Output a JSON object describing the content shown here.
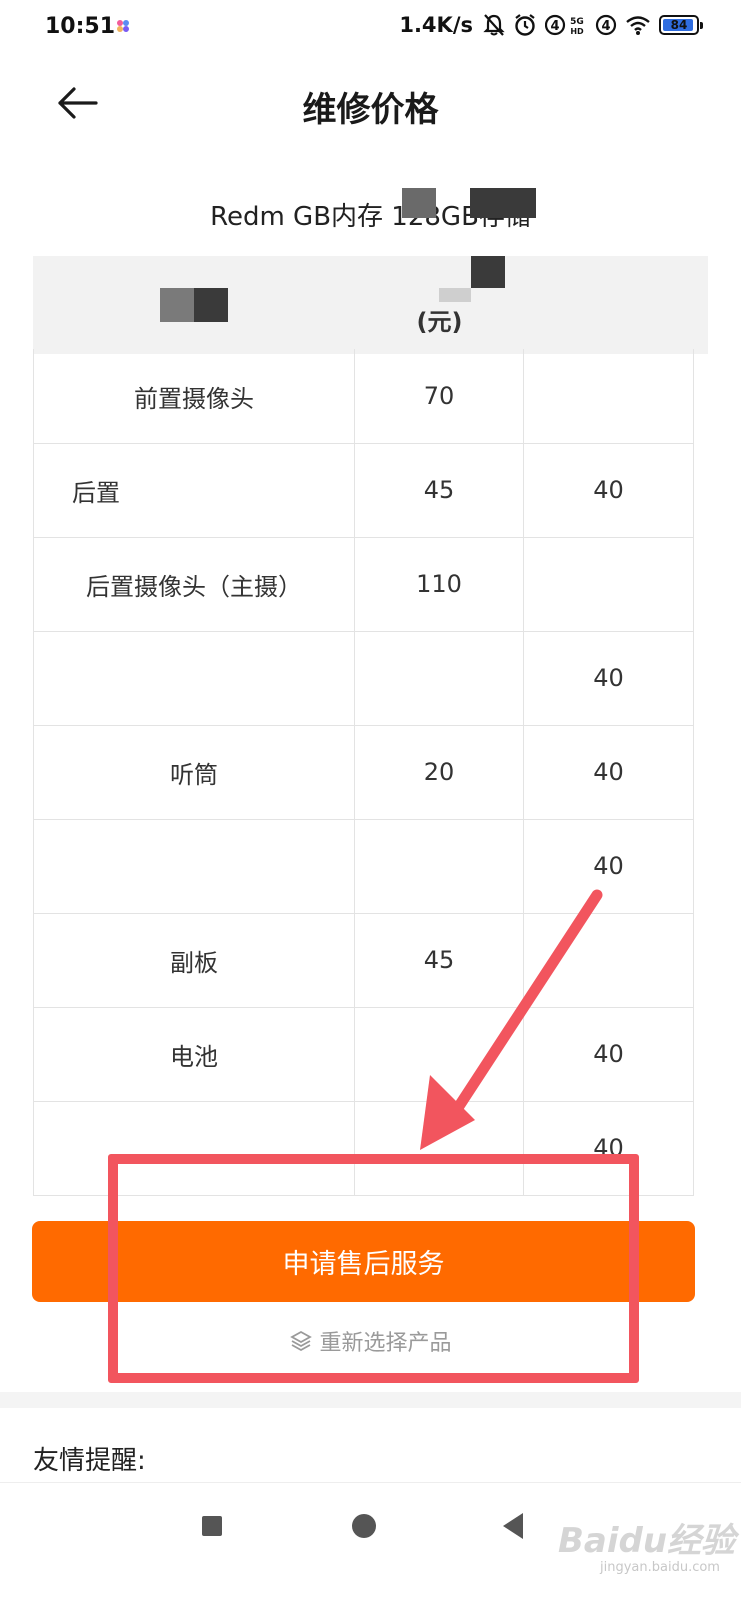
{
  "status_bar": {
    "time": "10:51",
    "net_speed": "1.4K/s",
    "battery": "84"
  },
  "header": {
    "title": "维修价格"
  },
  "product": {
    "name": "Redm           GB内存 128GB存储"
  },
  "table": {
    "header": {
      "col2_unit": "(元)"
    },
    "rows": [
      {
        "part": "前置摄像头",
        "price": "70",
        "labor": ""
      },
      {
        "part": "后置",
        "price": "45",
        "labor": "40"
      },
      {
        "part": "后置摄像头（主摄）",
        "price": "110",
        "labor": ""
      },
      {
        "part": "",
        "price": "",
        "labor": "40"
      },
      {
        "part": "听筒",
        "price": "20",
        "labor": "40"
      },
      {
        "part": "",
        "price": "",
        "labor": "40"
      },
      {
        "part": "副板",
        "price": "45",
        "labor": ""
      },
      {
        "part": "电池",
        "price": "",
        "labor": "40"
      },
      {
        "part": "",
        "price": "",
        "labor": "40"
      }
    ]
  },
  "actions": {
    "apply_label": "申请售后服务",
    "reselect_label": "重新选择产品"
  },
  "reminder": {
    "title": "友情提醒:"
  },
  "watermark": {
    "brand": "Baidu经验",
    "url": "jingyan.baidu.com"
  },
  "colors": {
    "accent": "#ff6a00",
    "highlight": "#f2555e"
  }
}
